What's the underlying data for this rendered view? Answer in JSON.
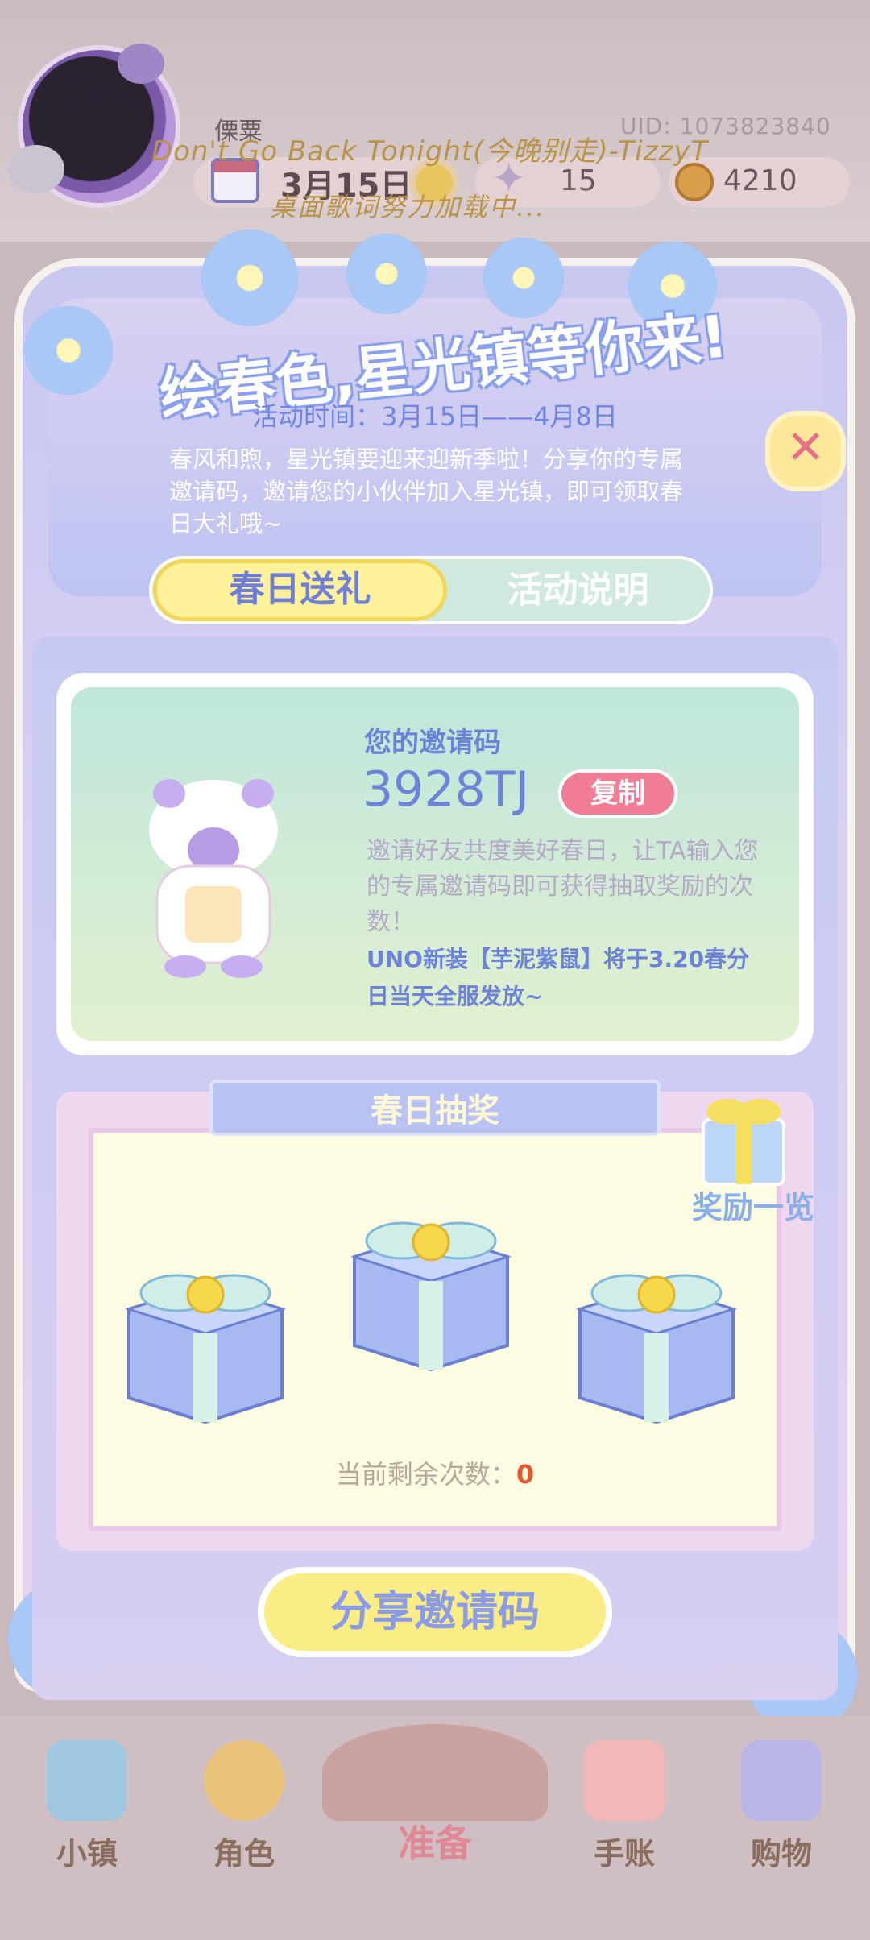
{
  "player": {
    "name": "傈粟",
    "uid": "UID: 1073823840"
  },
  "status": {
    "date": "3月15日",
    "stars": "15",
    "coins": "4210"
  },
  "overlay": {
    "lyrics_line1": "Don't Go Back Tonight(今晚别走)-TizzyT",
    "lyrics_line2": "桌面歌词努力加载中..."
  },
  "banner": {
    "title": "绘春色,星光镇等你来!",
    "event_time": "活动时间：3月15日——4月8日",
    "description": "春风和煦，星光镇要迎来迎新季啦！分享你的专属邀请码，邀请您的小伙伴加入星光镇，即可领取春日大礼哦~"
  },
  "tabs": [
    {
      "label": "春日送礼",
      "active": true
    },
    {
      "label": "活动说明",
      "active": false
    }
  ],
  "invite": {
    "label": "您的邀请码",
    "code": "3928TJ",
    "copy_label": "复制",
    "description": "邀请好友共度美好春日，让TA输入您的专属邀请码即可获得抽取奖励的次数！",
    "note": "UNO新装【芋泥紫鼠】将于3.20春分日当天全服发放~"
  },
  "lottery": {
    "title": "春日抽奖",
    "reward_preview_label": "奖励一览",
    "remaining_label": "当前剩余次数：",
    "remaining_count": "0"
  },
  "share_button": "分享邀请码",
  "nav": [
    {
      "label": "小镇",
      "icon": "map-icon"
    },
    {
      "label": "角色",
      "icon": "character-icon"
    },
    {
      "label": "准备",
      "icon": "picnic-basket-icon"
    },
    {
      "label": "手账",
      "icon": "notebook-icon"
    },
    {
      "label": "购物",
      "icon": "shopping-bag-icon"
    }
  ],
  "colors": {
    "accent_blue": "#6d83d8",
    "pink": "#f07d95",
    "yellow": "#fbed86",
    "mint": "#bfe6dc"
  }
}
